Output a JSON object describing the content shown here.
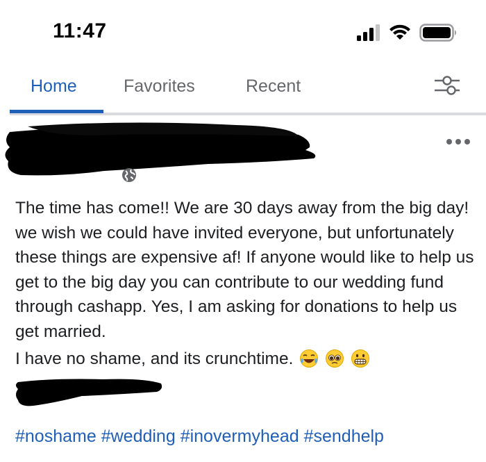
{
  "status_bar": {
    "time": "11:47",
    "icons": [
      "signal-icon",
      "wifi-icon",
      "battery-icon"
    ]
  },
  "tabs": [
    {
      "label": "Home",
      "active": true
    },
    {
      "label": "Favorites",
      "active": false
    },
    {
      "label": "Recent",
      "active": false
    }
  ],
  "colors": {
    "accent": "#1f5fb8",
    "muted": "#65676b",
    "text": "#1c1e21",
    "divider": "#d9dadd"
  },
  "post": {
    "author_redacted": true,
    "privacy_icon": "globe-icon",
    "body": "The time has come!! We are 30 days away from the big day! we wish we could have invited everyone, but unfortunately these things are expensive af! If anyone would like to help us get to the big day you can contribute to our wedding fund through cashapp. Yes, I am asking for donations to help us get married.",
    "last_line": "I have no shame, and its crunchtime.",
    "emojis": [
      "laughing-emoji-icon",
      "pleading-emoji-icon",
      "grimacing-emoji-icon"
    ],
    "signature_redacted": true,
    "hashtags": [
      "#noshame",
      "#wedding",
      "#inovermyhead",
      "#sendhelp"
    ]
  }
}
